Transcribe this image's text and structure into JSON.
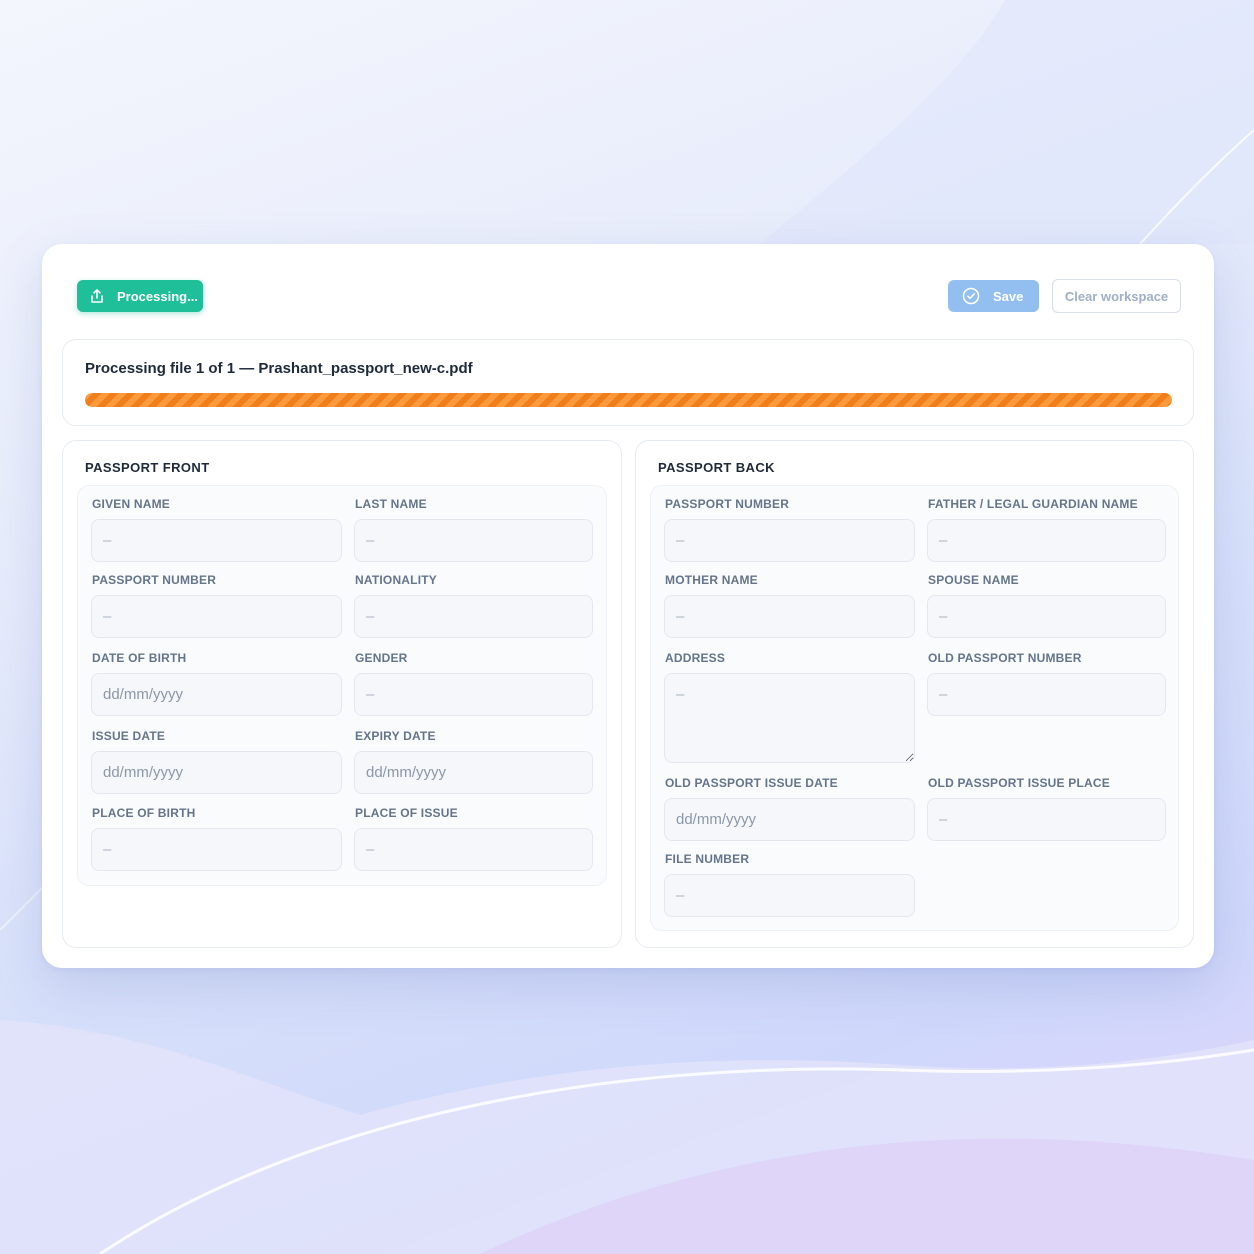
{
  "toolbar": {
    "processing_label": "Processing...",
    "save_label": "Save",
    "clear_label": "Clear workspace"
  },
  "progress": {
    "text": "Processing file 1 of 1 — Prashant_passport_new-c.pdf",
    "value": 1.0,
    "color": "#f7922e"
  },
  "front": {
    "title": "PASSPORT FRONT",
    "fields": {
      "given_name": {
        "label": "GIVEN NAME",
        "placeholder": "–"
      },
      "last_name": {
        "label": "LAST NAME",
        "placeholder": "–"
      },
      "passport_number": {
        "label": "PASSPORT NUMBER",
        "placeholder": "–"
      },
      "nationality": {
        "label": "NATIONALITY",
        "placeholder": "–"
      },
      "date_of_birth": {
        "label": "DATE OF BIRTH",
        "placeholder": "dd/mm/yyyy"
      },
      "gender": {
        "label": "GENDER",
        "placeholder": "–"
      },
      "issue_date": {
        "label": "ISSUE DATE",
        "placeholder": "dd/mm/yyyy"
      },
      "expiry_date": {
        "label": "EXPIRY DATE",
        "placeholder": "dd/mm/yyyy"
      },
      "place_of_birth": {
        "label": "PLACE OF BIRTH",
        "placeholder": "–"
      },
      "place_of_issue": {
        "label": "PLACE OF ISSUE",
        "placeholder": "–"
      }
    }
  },
  "back": {
    "title": "PASSPORT BACK",
    "fields": {
      "passport_number": {
        "label": "PASSPORT NUMBER",
        "placeholder": "–"
      },
      "guardian_name": {
        "label": "FATHER / LEGAL GUARDIAN NAME",
        "placeholder": "–"
      },
      "mother_name": {
        "label": "MOTHER NAME",
        "placeholder": "–"
      },
      "spouse_name": {
        "label": "SPOUSE NAME",
        "placeholder": "–"
      },
      "address": {
        "label": "ADDRESS",
        "placeholder": "–"
      },
      "old_passport_number": {
        "label": "OLD PASSPORT NUMBER",
        "placeholder": "–"
      },
      "old_passport_issue_date": {
        "label": "OLD PASSPORT ISSUE DATE",
        "placeholder": "dd/mm/yyyy"
      },
      "old_passport_issue_place": {
        "label": "OLD PASSPORT ISSUE PLACE",
        "placeholder": "–"
      },
      "file_number": {
        "label": "FILE NUMBER",
        "placeholder": "–"
      }
    }
  },
  "colors": {
    "accent_green": "#1fbf9a",
    "save_blue": "#93bff0",
    "progress_orange": "#f7922e"
  },
  "icons": {
    "processing": "upload-icon",
    "save": "check-circle-icon"
  }
}
